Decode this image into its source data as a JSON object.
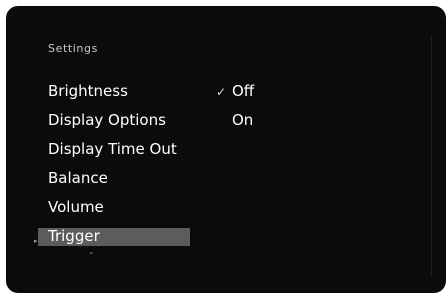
{
  "settings_menu": {
    "title": "Settings",
    "items": [
      {
        "label": "Brightness"
      },
      {
        "label": "Display Options"
      },
      {
        "label": "Display Time Out"
      },
      {
        "label": "Balance"
      },
      {
        "label": "Volume"
      },
      {
        "label": "Trigger",
        "selected": true
      }
    ],
    "more_indicator_icon": "chevron-down-icon",
    "selection_marker_icon": "triangle-right-icon"
  },
  "options": {
    "items": [
      {
        "label": "Off",
        "checked": true,
        "check_glyph": "✓"
      },
      {
        "label": "On",
        "checked": false,
        "check_glyph": ""
      }
    ]
  },
  "colors": {
    "panel_bg": "#0b0b0b",
    "text": "#ffffff",
    "title_text": "#c9c9c9",
    "highlight": "#5c5c5c"
  }
}
